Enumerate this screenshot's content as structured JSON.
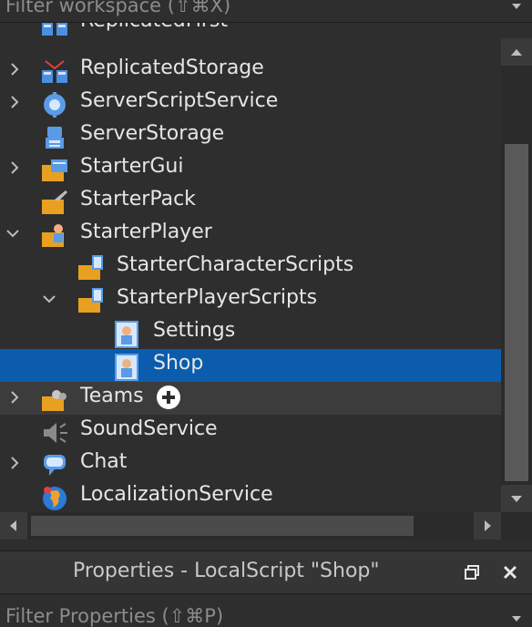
{
  "explorer": {
    "filter_placeholder": "Filter workspace (⇧⌘X)",
    "items": [
      {
        "label": "ReplicatedFirst",
        "icon": "replicated-first-icon"
      },
      {
        "label": "ReplicatedStorage",
        "icon": "replicated-storage-icon"
      },
      {
        "label": "ServerScriptService",
        "icon": "server-script-service-icon"
      },
      {
        "label": "ServerStorage",
        "icon": "server-storage-icon"
      },
      {
        "label": "StarterGui",
        "icon": "starter-gui-icon"
      },
      {
        "label": "StarterPack",
        "icon": "starter-pack-icon"
      },
      {
        "label": "StarterPlayer",
        "icon": "starter-player-icon"
      },
      {
        "label": "StarterCharacterScripts",
        "icon": "starter-character-scripts-icon"
      },
      {
        "label": "StarterPlayerScripts",
        "icon": "starter-player-scripts-icon"
      },
      {
        "label": "Settings",
        "icon": "local-script-icon"
      },
      {
        "label": "Shop",
        "icon": "local-script-icon",
        "selected": true
      },
      {
        "label": "Teams",
        "icon": "teams-icon"
      },
      {
        "label": "SoundService",
        "icon": "sound-service-icon"
      },
      {
        "label": "Chat",
        "icon": "chat-icon"
      },
      {
        "label": "LocalizationService",
        "icon": "localization-service-icon"
      }
    ]
  },
  "properties": {
    "title": "Properties - LocalScript \"Shop\"",
    "filter_placeholder": "Filter Properties (⇧⌘P)"
  },
  "colors": {
    "background": "#2e2e2e",
    "selection": "#0b5cad",
    "text": "#e6e6e6"
  }
}
